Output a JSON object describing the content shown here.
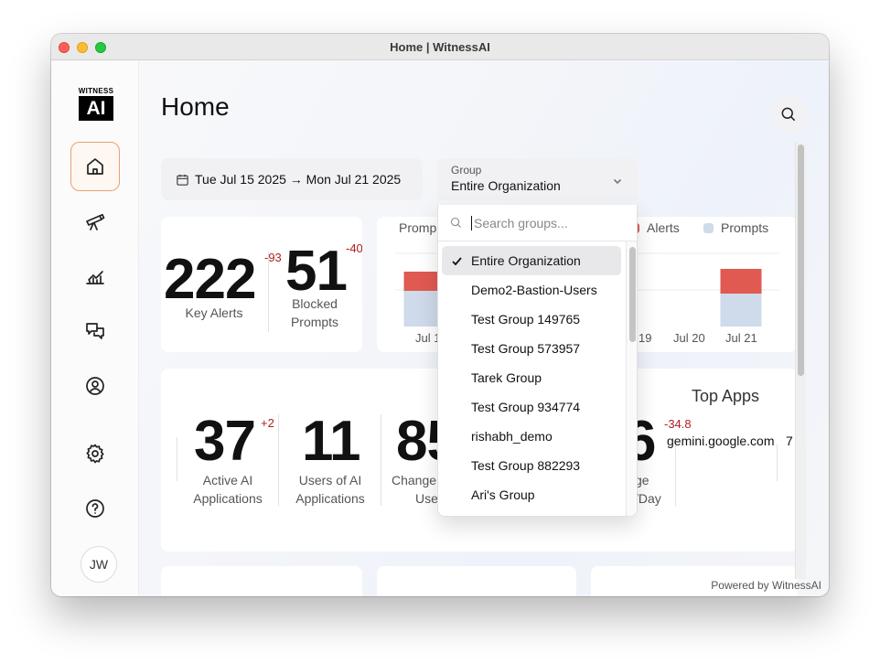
{
  "window": {
    "title": "Home | WitnessAI"
  },
  "logo": {
    "top_text": "WITNESS",
    "box_text": "AI"
  },
  "sidebar": {
    "items": [
      {
        "name": "home",
        "icon": "home-icon",
        "active": true
      },
      {
        "name": "explore",
        "icon": "telescope-icon",
        "active": false
      },
      {
        "name": "analytics",
        "icon": "chart-icon",
        "active": false
      },
      {
        "name": "conversations",
        "icon": "chat-icon",
        "active": false
      },
      {
        "name": "users",
        "icon": "user-circle-icon",
        "active": false
      },
      {
        "name": "settings",
        "icon": "gear-icon",
        "active": false
      },
      {
        "name": "help",
        "icon": "help-icon",
        "active": false
      }
    ],
    "avatar_initials": "JW"
  },
  "page": {
    "title": "Home"
  },
  "filters": {
    "date_range": "Tue Jul 15 2025 → Mon Jul 21 2025",
    "group_label": "Group",
    "group_value": "Entire Organization"
  },
  "kpis": {
    "key_alerts": {
      "value": "222",
      "delta": "-93",
      "label": "Key Alerts"
    },
    "blocked_prompts": {
      "value": "51",
      "delta": "-40",
      "label_line1": "Blocked",
      "label_line2": "Prompts"
    }
  },
  "chart": {
    "legend_left": "Promp",
    "legend": [
      {
        "name": "Alerts",
        "color": "#e05a52"
      },
      {
        "name": "Prompts",
        "color": "#cfdaea"
      }
    ],
    "x_labels": [
      "Jul 1",
      "19",
      "Jul 20",
      "Jul 21"
    ]
  },
  "chart_data": {
    "type": "bar",
    "categories": [
      "Jul 1",
      "19",
      "Jul 20",
      "Jul 21"
    ],
    "series": [
      {
        "name": "Prompts",
        "values": [
          39,
          0,
          0,
          36
        ]
      },
      {
        "name": "Alerts",
        "values": [
          21,
          0,
          0,
          27
        ]
      }
    ],
    "ylim": [
      0,
      80
    ],
    "grid": true,
    "legend": "top"
  },
  "stats": [
    {
      "value": "37",
      "delta": "+2",
      "label_line1": "Active AI",
      "label_line2": "Applications"
    },
    {
      "value": "11",
      "delta": "",
      "label_line1": "Users of AI",
      "label_line2": "Applications"
    },
    {
      "value": "85",
      "delta": "",
      "label_line1": "Change",
      "label_line2": "Use"
    },
    {
      "value": "6",
      "delta": "-34.8",
      "label_line1": "ge",
      "label_line2": "/Day"
    }
  ],
  "top_apps": {
    "title": "Top Apps",
    "rows": [
      {
        "name": "gemini.google.com",
        "count": "7"
      }
    ]
  },
  "footer": {
    "powered_by": "Powered by WitnessAI"
  },
  "dropdown": {
    "search_placeholder": "Search groups...",
    "items": [
      {
        "label": "Entire Organization",
        "selected": true
      },
      {
        "label": "Demo2-Bastion-Users",
        "selected": false
      },
      {
        "label": "Test Group 149765",
        "selected": false
      },
      {
        "label": "Test Group 573957",
        "selected": false
      },
      {
        "label": "Tarek Group",
        "selected": false
      },
      {
        "label": "Test Group 934774",
        "selected": false
      },
      {
        "label": "rishabh_demo",
        "selected": false
      },
      {
        "label": "Test Group 882293",
        "selected": false
      },
      {
        "label": "Ari's Group",
        "selected": false
      }
    ]
  }
}
